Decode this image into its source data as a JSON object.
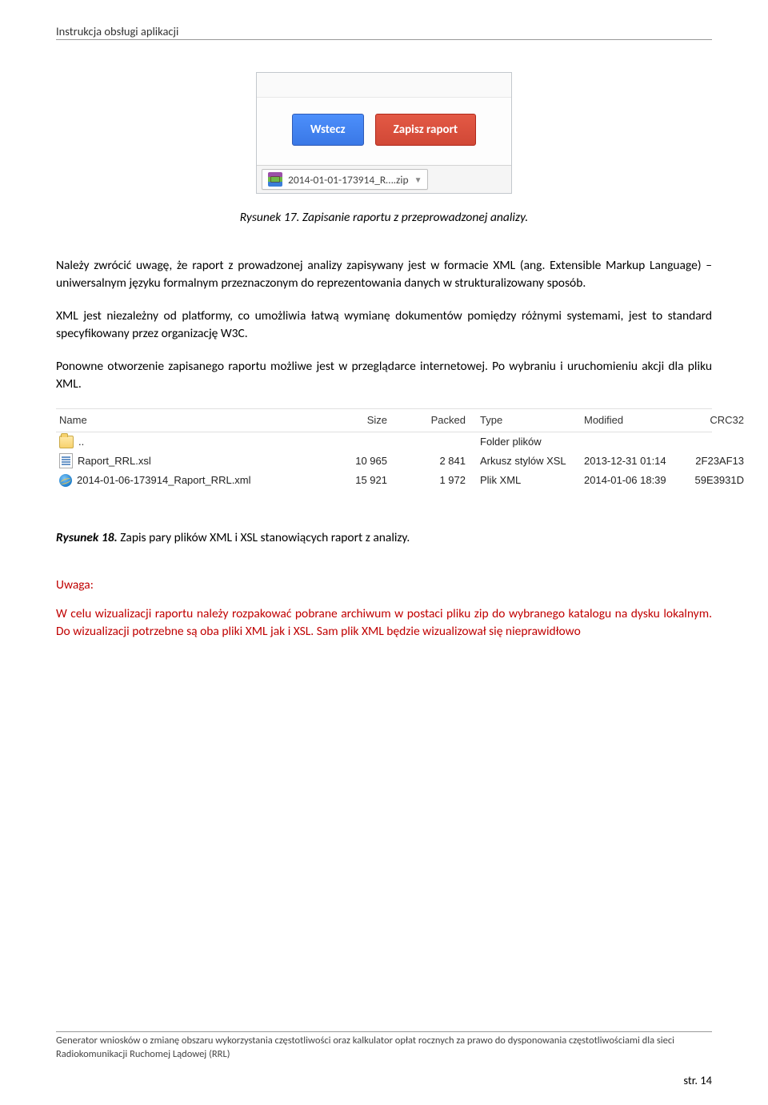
{
  "header": "Instrukcja obsługi aplikacji",
  "shot1": {
    "back": "Wstecz",
    "save": "Zapisz raport",
    "download_file": "2014-01-01-173914_R….zip"
  },
  "caption1": "Rysunek 17. Zapisanie raportu z przeprowadzonej analizy.",
  "para1": "Należy zwrócić uwagę, że raport z prowadzonej analizy zapisywany jest w formacie XML (ang. Extensible Markup Language) – uniwersalnym języku formalnym przeznaczonym do reprezentowania danych w strukturalizowany sposób.",
  "para2": "XML jest niezależny od platformy, co umożliwia łatwą wymianę dokumentów pomiędzy różnymi systemami, jest to standard specyfikowany przez organizację W3C.",
  "para3": "Ponowne otworzenie zapisanego raportu możliwe jest w przeglądarce internetowej. Po wybraniu i uruchomieniu akcji dla pliku XML.",
  "table": {
    "head": {
      "name": "Name",
      "size": "Size",
      "packed": "Packed",
      "type": "Type",
      "mod": "Modified",
      "crc": "CRC32"
    },
    "rows": [
      {
        "icon": "folder",
        "name": "..",
        "size": "",
        "packed": "",
        "type": "Folder plików",
        "mod": "",
        "crc": ""
      },
      {
        "icon": "xsl",
        "name": "Raport_RRL.xsl",
        "size": "10 965",
        "packed": "2 841",
        "type": "Arkusz stylów XSL",
        "mod": "2013-12-31 01:14",
        "crc": "2F23AF13"
      },
      {
        "icon": "ie",
        "name": "2014-01-06-173914_Raport_RRL.xml",
        "size": "15 921",
        "packed": "1 972",
        "type": "Plik XML",
        "mod": "2014-01-06 18:39",
        "crc": "59E3931D"
      }
    ]
  },
  "caption2": {
    "lbl": "Rysunek 18.",
    "txt": " Zapis pary plików XML i XSL stanowiących raport z analizy."
  },
  "warn_head": "Uwaga:",
  "warn_body": "W celu wizualizacji raportu należy rozpakować pobrane archiwum w postaci pliku zip do wybranego katalogu na dysku lokalnym. Do wizualizacji potrzebne są oba pliki XML jak i XSL. Sam plik XML będzie wizualizował się nieprawidłowo",
  "footer": "Generator wniosków o zmianę obszaru wykorzystania częstotliwości oraz kalkulator opłat rocznych za prawo do dysponowania częstotliwościami dla sieci Radiokomunikacji Ruchomej Lądowej (RRL)",
  "page": "str. 14"
}
